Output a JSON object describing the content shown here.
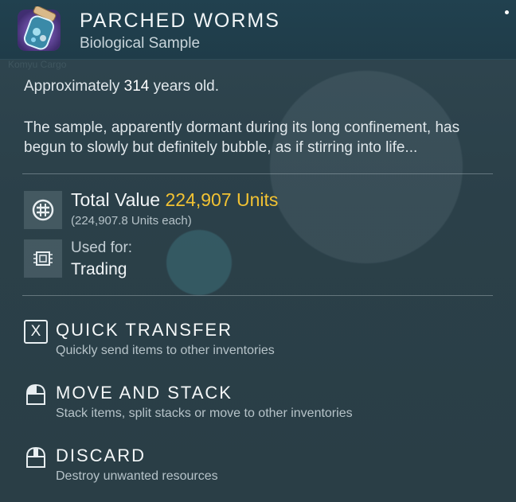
{
  "item": {
    "name": "PARCHED WORMS",
    "category": "Biological Sample",
    "age_prefix": "Approximately",
    "age_value": "314",
    "age_suffix": "years old.",
    "description": "The sample, apparently dormant during its long confinement, has begun to slowly but definitely bubble, as if stirring into life..."
  },
  "value": {
    "label": "Total Value",
    "amount": "224,907 Units",
    "each": "(224,907.8 Units each)"
  },
  "usage": {
    "label": "Used for:",
    "value": "Trading"
  },
  "actions": [
    {
      "key": "X",
      "title": "QUICK TRANSFER",
      "desc": "Quickly send items to other inventories"
    },
    {
      "title": "MOVE AND STACK",
      "desc": "Stack items, split stacks or move to other inventories"
    },
    {
      "title": "DISCARD",
      "desc": "Destroy unwanted resources"
    }
  ],
  "colors": {
    "accent_value": "#f2c233",
    "header_bg": "#21414f"
  },
  "icons": {
    "item": "worm-jar-icon",
    "value": "units-icon",
    "usage": "chip-icon",
    "mouse": "mouse-icon"
  }
}
